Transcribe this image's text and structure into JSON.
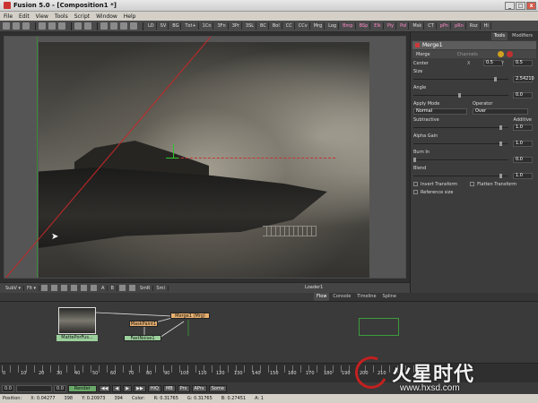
{
  "window": {
    "title": "Fusion 5.0 - [Composition1 *]",
    "min": "_",
    "max": "□",
    "close": "x"
  },
  "menu": [
    "File",
    "Edit",
    "View",
    "Tools",
    "Script",
    "Window",
    "Help"
  ],
  "tools": [
    "LD",
    "SV",
    "BG",
    "Txt+",
    "1Cn",
    "3Fn",
    "3Pr",
    "3SL",
    "BC",
    "Bol",
    "CC",
    "CCv",
    "Mrg",
    "Log",
    "Bmp",
    "BSp",
    "Elk",
    "Ply",
    "Pol",
    "Msk",
    "CT",
    "pPn",
    "pRn",
    "Rsz",
    "Hi"
  ],
  "viewer": {
    "subview": "SubV ▾",
    "fit": "Fit ▾",
    "label": "Loader1",
    "small_opts": [
      "A",
      "B",
      "SmR",
      "Sml"
    ]
  },
  "panel": {
    "tabs": [
      "Tools",
      "Modifiers"
    ],
    "node_title": "Merge1",
    "sub_tabs": [
      "Merge",
      "Channels"
    ],
    "center": {
      "label": "Center",
      "x_axis": "X",
      "x": "0.5",
      "y_axis": "Y",
      "y": "0.5"
    },
    "size": {
      "label": "Size",
      "value": "2.54210"
    },
    "angle": {
      "label": "Angle",
      "value": "0.0"
    },
    "apply_mode": {
      "label": "Apply Mode",
      "value": "Normal"
    },
    "operator": {
      "label": "Operator",
      "value": "Over"
    },
    "subtractive": "Subtractive",
    "additive": "Additive",
    "additive_value": "1.0",
    "alpha_gain": {
      "label": "Alpha Gain",
      "value": "1.0"
    },
    "burn_in": {
      "label": "Burn In",
      "value": "0.0"
    },
    "blend": {
      "label": "Blend",
      "value": "1.0"
    },
    "invert_transform": "Invert Transform",
    "flatten_transform": "Flatten Transform",
    "reference_size": "Reference size"
  },
  "flow": {
    "tabs": [
      "Flow",
      "Console",
      "Timeline",
      "Spline"
    ],
    "nodes": {
      "merge": "Merge1 (Mrg)",
      "mask": "MaskPaint1",
      "fast": "FastNoise1",
      "loader": "MattePorFus..."
    }
  },
  "timeline": {
    "ticks": [
      "0",
      "10",
      "20",
      "30",
      "40",
      "50",
      "60",
      "70",
      "80",
      "90",
      "100",
      "110",
      "120",
      "130",
      "140",
      "150",
      "160",
      "170",
      "180",
      "190",
      "200",
      "210"
    ]
  },
  "transport": {
    "start": "0.0",
    "current": "0.0",
    "render": "Render",
    "buttons": [
      "HiQ",
      "MB",
      "Prx",
      "APrx",
      "Some"
    ]
  },
  "status": {
    "position": "Position:",
    "x": "X: 0.04277",
    "x_px": "398",
    "y": "Y: 0.20973",
    "y_px": "394",
    "color": "Color:",
    "r": "R: 0.31765",
    "g": "G: 0.31765",
    "b": "B: 0.27451",
    "a": "A: 1"
  },
  "watermark": {
    "title": "火星时代",
    "url": "www.hxsd.com"
  },
  "colors": {
    "accent": "#c73232",
    "node_green": "#9bcf9b",
    "node_orange": "#e8b070"
  }
}
